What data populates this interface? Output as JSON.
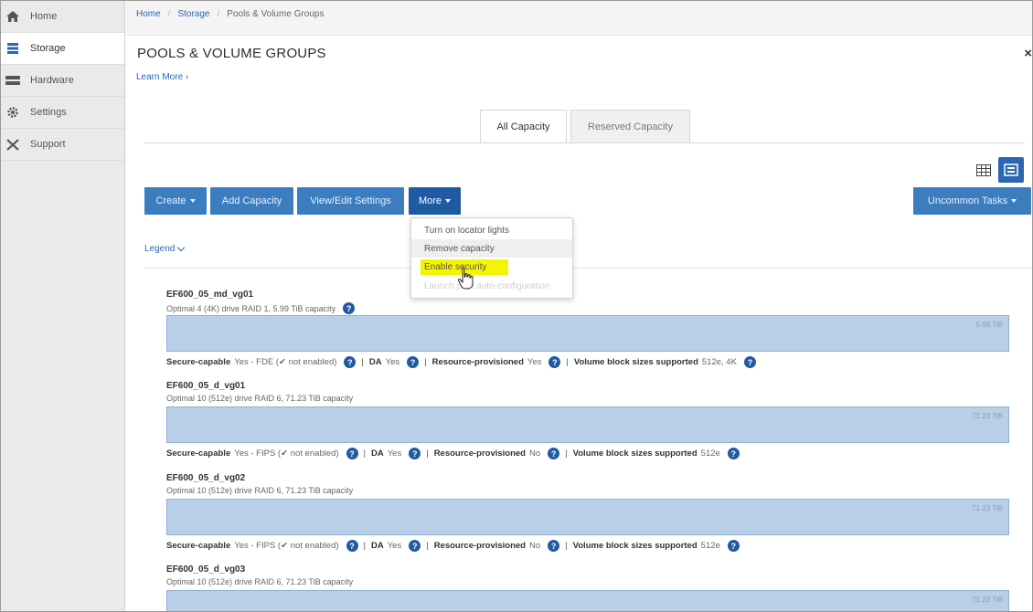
{
  "sidebar": {
    "items": [
      {
        "label": "Home",
        "icon": "home-icon"
      },
      {
        "label": "Storage",
        "icon": "storage-icon"
      },
      {
        "label": "Hardware",
        "icon": "hardware-icon"
      },
      {
        "label": "Settings",
        "icon": "gear-icon"
      },
      {
        "label": "Support",
        "icon": "tools-icon"
      }
    ],
    "active_index": 1
  },
  "breadcrumb": {
    "home": "Home",
    "storage": "Storage",
    "current": "Pools & Volume Groups"
  },
  "page": {
    "title": "POOLS & VOLUME GROUPS",
    "learn_more": "Learn More ›",
    "close": "×"
  },
  "tabs": {
    "all_capacity": "All Capacity",
    "reserved_capacity": "Reserved Capacity"
  },
  "toolbar": {
    "create": "Create",
    "add_capacity": "Add Capacity",
    "view_edit": "View/Edit Settings",
    "more": "More",
    "uncommon_tasks": "Uncommon Tasks"
  },
  "more_menu": {
    "items": [
      "Turn on locator lights",
      "Remove capacity",
      "Enable security",
      "Launch pool auto-configuration"
    ]
  },
  "legend": "Legend",
  "pools": [
    {
      "name": "EF600_05_md_vg01",
      "description": "Optimal 4 (4K) drive RAID 1, 5.99 TiB capacity",
      "capacity_label": "5.99 TiB",
      "secure_capable_key": "Secure-capable",
      "secure_capable_val": "Yes - FDE (✔ not enabled)",
      "da_key": "DA",
      "da_val": "Yes",
      "resource_key": "Resource-provisioned",
      "resource_val": "Yes",
      "block_key": "Volume block sizes supported",
      "block_val": "512e, 4K"
    },
    {
      "name": "EF600_05_d_vg01",
      "description": "Optimal 10 (512e) drive RAID 6, 71.23 TiB capacity",
      "capacity_label": "71.23 TiB",
      "secure_capable_key": "Secure-capable",
      "secure_capable_val": "Yes - FIPS (✔ not enabled)",
      "da_key": "DA",
      "da_val": "Yes",
      "resource_key": "Resource-provisioned",
      "resource_val": "No",
      "block_key": "Volume block sizes supported",
      "block_val": "512e"
    },
    {
      "name": "EF600_05_d_vg02",
      "description": "Optimal 10 (512e) drive RAID 6, 71.23 TiB capacity",
      "capacity_label": "71.23 TiB",
      "secure_capable_key": "Secure-capable",
      "secure_capable_val": "Yes - FIPS (✔ not enabled)",
      "da_key": "DA",
      "da_val": "Yes",
      "resource_key": "Resource-provisioned",
      "resource_val": "No",
      "block_key": "Volume block sizes supported",
      "block_val": "512e"
    },
    {
      "name": "EF600_05_d_vg03",
      "description": "Optimal 10 (512e) drive RAID 6, 71.23 TiB capacity",
      "capacity_label": "71.23 TiB"
    }
  ],
  "help_glyph": "?",
  "colors": {
    "accent": "#2b67b0",
    "button": "#3b7dbf",
    "button_active": "#1f5aa3",
    "bar_fill": "#b8cfe7",
    "highlight": "#f5f500"
  }
}
